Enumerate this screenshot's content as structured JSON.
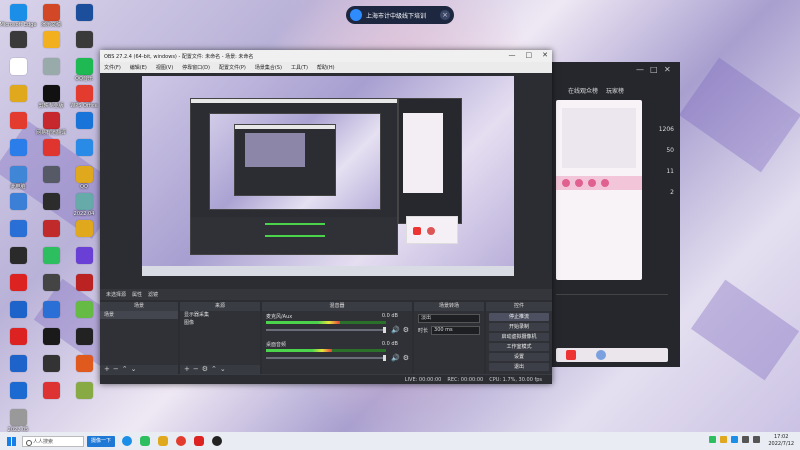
{
  "notification": {
    "text": "上海市计中级线下培训"
  },
  "desktop_icons": [
    {
      "label": "Microsoft Edge",
      "color": "#1b8ee8"
    },
    {
      "label": "演示文稿",
      "color": "#d24726"
    },
    {
      "label": "",
      "color": "#1b4f9b"
    },
    {
      "label": "",
      "color": "#3a3a3a"
    },
    {
      "label": "",
      "color": "#f2b01e"
    },
    {
      "label": "",
      "color": "#3a3a3a"
    },
    {
      "label": "",
      "color": "#ffffff"
    },
    {
      "label": "",
      "color": "#9aa"
    },
    {
      "label": "QQ音乐",
      "color": "#1fb954"
    },
    {
      "label": "",
      "color": "#e0a81c"
    },
    {
      "label": "剪映专业版",
      "color": "#111111"
    },
    {
      "label": "WPS Office",
      "color": "#e33b2e"
    },
    {
      "label": "",
      "color": "#e33b2e"
    },
    {
      "label": "网易有道翻译",
      "color": "#c7282e"
    },
    {
      "label": "",
      "color": "#1874d9"
    },
    {
      "label": "",
      "color": "#2b7de9"
    },
    {
      "label": "",
      "color": "#e0342e"
    },
    {
      "label": "",
      "color": "#2a8be6"
    },
    {
      "label": "此电脑",
      "color": "#3f87d6"
    },
    {
      "label": "",
      "color": "#555a66"
    },
    {
      "label": "QQ",
      "color": "#e0a81c"
    },
    {
      "label": "",
      "color": "#3b7fd6"
    },
    {
      "label": "",
      "color": "#2c2c2c"
    },
    {
      "label": "2022.04",
      "color": "#6aa"
    },
    {
      "label": "",
      "color": "#2a6fd6"
    },
    {
      "label": "",
      "color": "#c02a2a"
    },
    {
      "label": "",
      "color": "#e0a81c"
    },
    {
      "label": "",
      "color": "#2a2a2a"
    },
    {
      "label": "",
      "color": "#2dbf5f"
    },
    {
      "label": "",
      "color": "#6a3fd6"
    },
    {
      "label": "",
      "color": "#d22"
    },
    {
      "label": "",
      "color": "#444"
    },
    {
      "label": "",
      "color": "#b22"
    },
    {
      "label": "",
      "color": "#1d63c9"
    },
    {
      "label": "",
      "color": "#2a6fd6"
    },
    {
      "label": "",
      "color": "#6b4"
    },
    {
      "label": "",
      "color": "#d22"
    },
    {
      "label": "",
      "color": "#1a1a1a"
    },
    {
      "label": "",
      "color": "#222"
    },
    {
      "label": "",
      "color": "#1d63c9"
    },
    {
      "label": "",
      "color": "#333"
    },
    {
      "label": "",
      "color": "#e05a1e"
    },
    {
      "label": "",
      "color": "#1a6ad2"
    },
    {
      "label": "",
      "color": "#d33"
    },
    {
      "label": "",
      "color": "#8a4"
    },
    {
      "label": "2022.05",
      "color": "#999"
    }
  ],
  "side_panel": {
    "tabs": [
      "在线观众榜",
      "玩家榜"
    ],
    "numbers": [
      "1206",
      "50",
      "11",
      "2"
    ],
    "window_controls": [
      "—",
      "□",
      "✕"
    ]
  },
  "obs": {
    "title": "OBS 27.2.4 (64-bit, windows) - 配置文件: 未命名 - 场景: 未命名",
    "menu": [
      "文件(F)",
      "编辑(E)",
      "视图(V)",
      "停靠窗口(D)",
      "配置文件(P)",
      "场景集合(S)",
      "工具(T)",
      "帮助(H)"
    ],
    "source_bar": [
      "未选择源",
      "属性",
      "滤镜"
    ],
    "docks": {
      "scenes": {
        "title": "场景",
        "items": [
          "场景"
        ]
      },
      "sources": {
        "title": "来源",
        "items": [
          "显示器采集",
          "图像"
        ]
      },
      "mixer": {
        "title": "混音器",
        "channels": [
          {
            "name": "麦克风/Aux",
            "db": "0.0 dB",
            "level": 0.62
          },
          {
            "name": "桌面音频",
            "db": "0.0 dB",
            "level": 0.55
          }
        ]
      },
      "transitions": {
        "title": "场景转场",
        "type": "淡出",
        "duration_label": "时长",
        "duration": "300 ms"
      },
      "controls": {
        "title": "控件",
        "buttons": [
          "停止推流",
          "开始录制",
          "启动虚拟摄像机",
          "工作室模式",
          "设置",
          "退出"
        ]
      }
    },
    "status": [
      "LIVE: 00:00:00",
      "REC: 00:00:00",
      "CPU: 1.7%, 30.00 fps"
    ]
  },
  "taskbar": {
    "search_placeholder": "人人搜索",
    "pinned_label": "摄像一下",
    "clock_time": "17:02",
    "clock_date": "2022/7/12"
  },
  "colors": {
    "obs_bg": "#2b2d33",
    "taskbar_bg": "#e9ecf3",
    "accent_blue": "#1e78d6"
  }
}
